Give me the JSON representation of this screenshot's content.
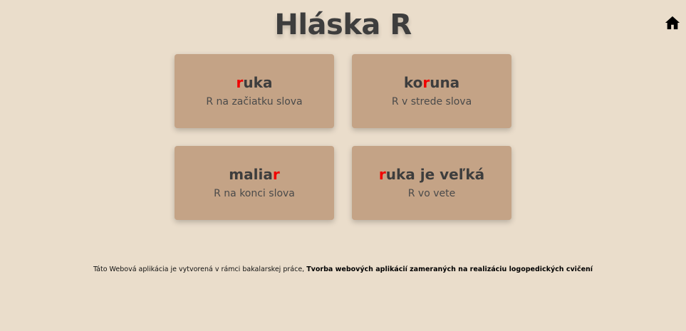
{
  "header": {
    "title": "Hláska R"
  },
  "nav": {
    "home_icon": "home-icon"
  },
  "cards": [
    {
      "pre": "",
      "hl": "r",
      "post": "uka",
      "subtitle": "R na začiatku slova"
    },
    {
      "pre": "ko",
      "hl": "r",
      "post": "una",
      "subtitle": "R v strede slova"
    },
    {
      "pre": "malia",
      "hl": "r",
      "post": "",
      "subtitle": "R na konci slova"
    },
    {
      "pre": "",
      "hl": "r",
      "post": "uka je veľká",
      "subtitle": "R vo vete"
    }
  ],
  "footer": {
    "text": "Táto Webová aplikácia je vytvorená v rámci bakalarskej práce, ",
    "bold": "Tvorba webových aplikácií zameraných na realizáciu logopedických cvičení"
  },
  "colors": {
    "background": "#eaddcb",
    "card": "#c4a386",
    "highlight": "#f00000",
    "text": "#3d3d3d"
  }
}
